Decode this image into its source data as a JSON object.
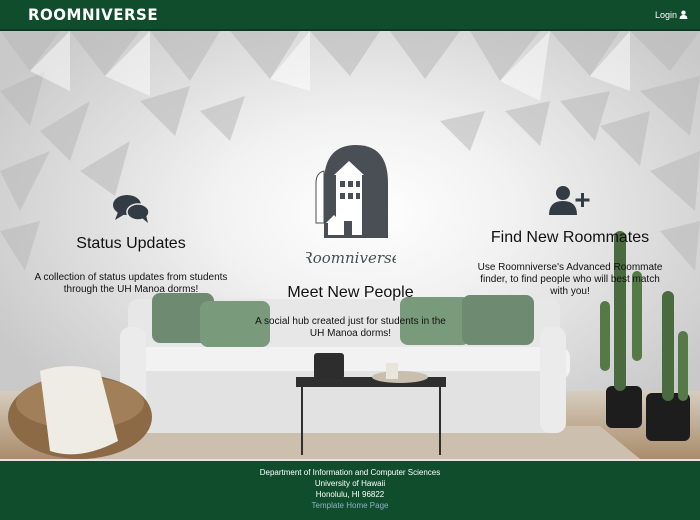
{
  "navbar": {
    "brand": "ROOMNIVERSE",
    "login_label": "Login",
    "login_icon": "user-icon"
  },
  "features": {
    "status": {
      "icon": "comments-icon",
      "title": "Status Updates",
      "description": "A collection of status updates from students through the UH Manoa dorms!"
    },
    "meet": {
      "logo_text": "Roomniverse",
      "title": "Meet New People",
      "description": "A social hub created just for students in the UH Manoa dorms!"
    },
    "roommates": {
      "icon": "user-plus-icon",
      "title": "Find New Roommates",
      "description": "Use Roomniverse's Advanced Roommate finder, to find people who will best match with you!"
    }
  },
  "footer": {
    "line1": "Department of Information and Computer Sciences",
    "line2": "University of Hawaii",
    "line3": "Honolulu, HI 96822",
    "link": "Template Home Page"
  },
  "colors": {
    "navbar": "#0f4d2c",
    "footer": "#0f4d2c",
    "logo": "#4a4f55"
  }
}
